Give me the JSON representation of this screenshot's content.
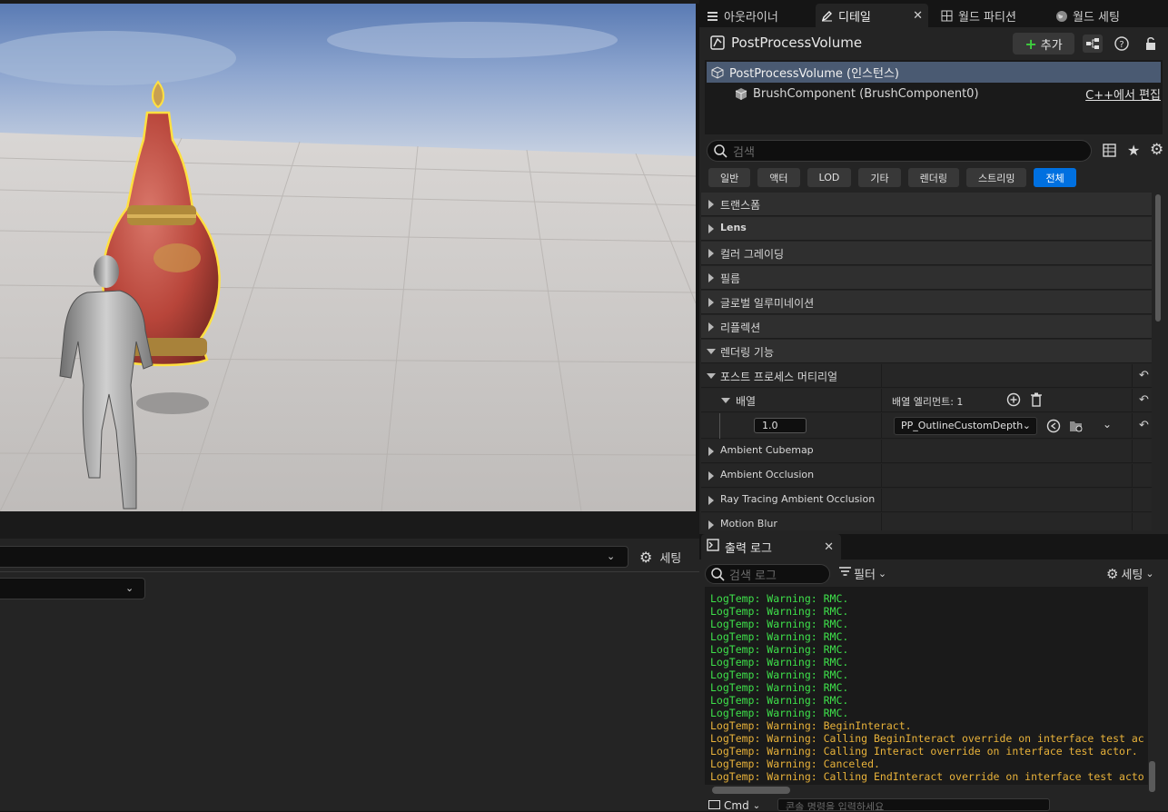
{
  "colors": {
    "accent": "#0070e0",
    "log_green": "#3ee04a",
    "log_yellow": "#e8b23a",
    "selection": "#4a5a72"
  },
  "left_panel": {
    "settings_label": "세팅"
  },
  "tabs": [
    {
      "label": "아웃라이너",
      "icon": "outliner-icon"
    },
    {
      "label": "디테일",
      "icon": "pencil-icon",
      "active": true
    },
    {
      "label": "월드 파티션",
      "icon": "world-partition-icon"
    },
    {
      "label": "월드 세팅",
      "icon": "globe-icon"
    }
  ],
  "details": {
    "title": "PostProcessVolume",
    "add_label": "추가",
    "components": [
      {
        "label": "PostProcessVolume (인스턴스)"
      },
      {
        "label": "BrushComponent (BrushComponent0)",
        "link": "C++에서 편집"
      }
    ],
    "search_placeholder": "검색",
    "filters": [
      "일반",
      "액터",
      "LOD",
      "기타",
      "렌더링",
      "스트리밍",
      "전체"
    ],
    "active_filter": "전체",
    "categories": [
      "트랜스폼",
      "Lens",
      "컬러 그레이딩",
      "필름",
      "글로벌 일루미네이션",
      "리플렉션",
      "렌더링 기능"
    ],
    "pp_material_label": "포스트 프로세스 머티리얼",
    "array_label": "배열",
    "array_elements": "배열 엘리먼트: 1",
    "weight_value": "1.0",
    "material_value": "PP_OutlineCustomDepth",
    "sub_categories": [
      "Ambient Cubemap",
      "Ambient Occlusion",
      "Ray Tracing Ambient Occlusion",
      "Motion Blur"
    ]
  },
  "output_log": {
    "tab_label": "출력 로그",
    "search_placeholder": "검색 로그",
    "filter_label": "필터",
    "settings_label": "세팅",
    "lines": [
      {
        "text": "LogTemp: Warning: RMC.",
        "kind": "green"
      },
      {
        "text": "LogTemp: Warning: RMC.",
        "kind": "green"
      },
      {
        "text": "LogTemp: Warning: RMC.",
        "kind": "green"
      },
      {
        "text": "LogTemp: Warning: RMC.",
        "kind": "green"
      },
      {
        "text": "LogTemp: Warning: RMC.",
        "kind": "green"
      },
      {
        "text": "LogTemp: Warning: RMC.",
        "kind": "green"
      },
      {
        "text": "LogTemp: Warning: RMC.",
        "kind": "green"
      },
      {
        "text": "LogTemp: Warning: RMC.",
        "kind": "green"
      },
      {
        "text": "LogTemp: Warning: RMC.",
        "kind": "green"
      },
      {
        "text": "LogTemp: Warning: RMC.",
        "kind": "green"
      },
      {
        "text": "LogTemp: Warning: BeginInteract.",
        "kind": "yellow"
      },
      {
        "text": "LogTemp: Warning: Calling BeginInteract override on interface test ac",
        "kind": "yellow"
      },
      {
        "text": "LogTemp: Warning: Calling Interact override on interface test actor.",
        "kind": "yellow"
      },
      {
        "text": "LogTemp: Warning: Canceled.",
        "kind": "yellow"
      },
      {
        "text": "LogTemp: Warning: Calling EndInteract override on interface test acto",
        "kind": "yellow"
      }
    ],
    "cmd_label": "Cmd",
    "cmd_placeholder": "콘솔 명령을 입력하세요"
  }
}
